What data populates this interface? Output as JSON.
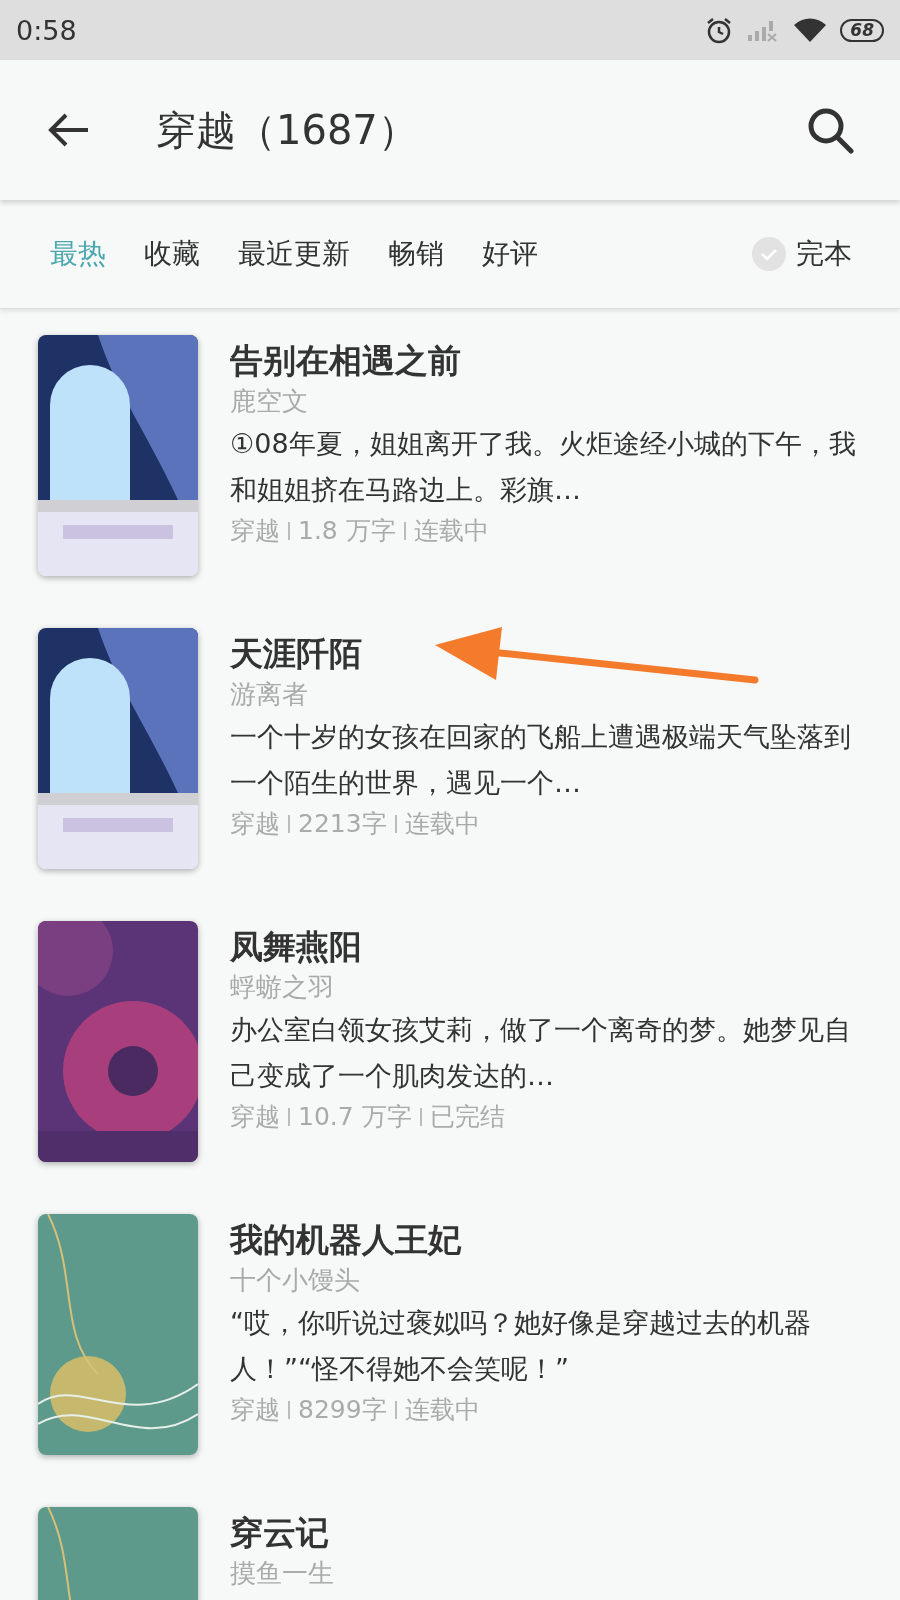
{
  "status_bar": {
    "time": "0:58",
    "battery": "68"
  },
  "app_bar": {
    "title": "穿越（1687）"
  },
  "filters": [
    {
      "label": "最热",
      "selected": true
    },
    {
      "label": "收藏",
      "selected": false
    },
    {
      "label": "最近更新",
      "selected": false
    },
    {
      "label": "畅销",
      "selected": false
    },
    {
      "label": "好评",
      "selected": false
    }
  ],
  "finished_toggle": {
    "label": "完本",
    "checked": false
  },
  "books": [
    {
      "title": "告别在相遇之前",
      "author": "鹿空文",
      "description": "①08年夏，姐姐离开了我。火炬途经小城的下午，我和姐姐挤在马路边上。彩旗…",
      "meta": [
        "穿越",
        "1.8 万字",
        "连载中"
      ]
    },
    {
      "title": "天涯阡陌",
      "author": "游离者",
      "description": "一个十岁的女孩在回家的飞船上遭遇极端天气坠落到一个陌生的世界，遇见一个…",
      "meta": [
        "穿越",
        "2213字",
        "连载中"
      ]
    },
    {
      "title": "凤舞燕阳",
      "author": "蜉蝣之羽",
      "description": "办公室白领女孩艾莉，做了一个离奇的梦。她梦见自己变成了一个肌肉发达的…",
      "meta": [
        "穿越",
        "10.7 万字",
        "已完结"
      ]
    },
    {
      "title": "我的机器人王妃",
      "author": "十个小馒头",
      "description": "“哎，你听说过褒姒吗？她好像是穿越过去的机器人！”“怪不得她不会笑呢！”",
      "meta": [
        "穿越",
        "8299字",
        "连载中"
      ]
    },
    {
      "title": "穿云记",
      "author": "摸鱼一生"
    }
  ],
  "annotations": [
    {
      "kind": "arrow"
    }
  ]
}
